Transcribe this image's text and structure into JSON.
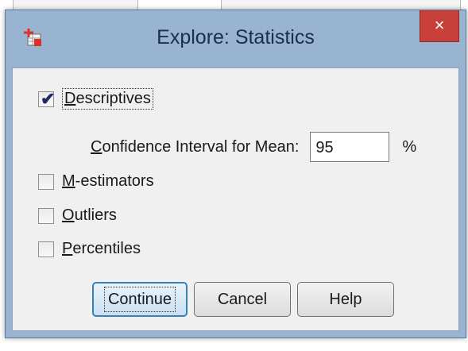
{
  "dialog": {
    "title": "Explore: Statistics",
    "close_glyph": "×",
    "icon": "spss-table-icon"
  },
  "options": {
    "descriptives": {
      "label_mn": "D",
      "label_rest": "escriptives",
      "checked": true
    },
    "ci": {
      "label_mn": "C",
      "label_rest": "onfidence Interval for Mean:",
      "value": "95",
      "unit": "%"
    },
    "m_estimators": {
      "label_mn": "M",
      "label_rest": "-estimators",
      "checked": false
    },
    "outliers": {
      "label_mn": "O",
      "label_rest": "utliers",
      "checked": false
    },
    "percentiles": {
      "label_mn": "P",
      "label_rest": "ercentiles",
      "checked": false
    }
  },
  "buttons": {
    "continue": "Continue",
    "cancel": "Cancel",
    "help": "Help"
  },
  "colors": {
    "frame": "#99b4d1",
    "close": "#c7403a",
    "default_button_border": "#3c7fb1"
  }
}
